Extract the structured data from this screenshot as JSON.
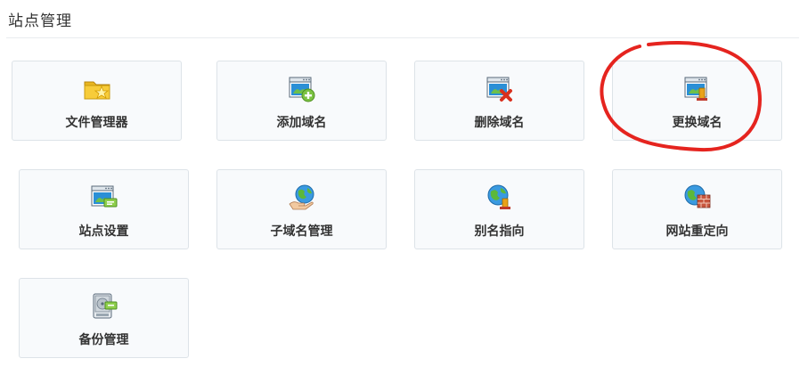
{
  "page": {
    "title": "站点管理"
  },
  "tiles": [
    {
      "label": "文件管理器",
      "icon": "folder-icon"
    },
    {
      "label": "添加域名",
      "icon": "add-domain-icon"
    },
    {
      "label": "删除域名",
      "icon": "delete-domain-icon"
    },
    {
      "label": "更换域名",
      "icon": "change-domain-icon"
    },
    {
      "label": "站点设置",
      "icon": "site-settings-icon"
    },
    {
      "label": "子域名管理",
      "icon": "subdomain-globe-icon"
    },
    {
      "label": "别名指向",
      "icon": "alias-globe-icon"
    },
    {
      "label": "网站重定向",
      "icon": "redirect-globe-icon"
    },
    {
      "label": "备份管理",
      "icon": "backup-disk-icon"
    }
  ],
  "colors": {
    "annotation": "#e5241f",
    "tile_background": "#f8fafc",
    "tile_border": "#dde3e8"
  }
}
